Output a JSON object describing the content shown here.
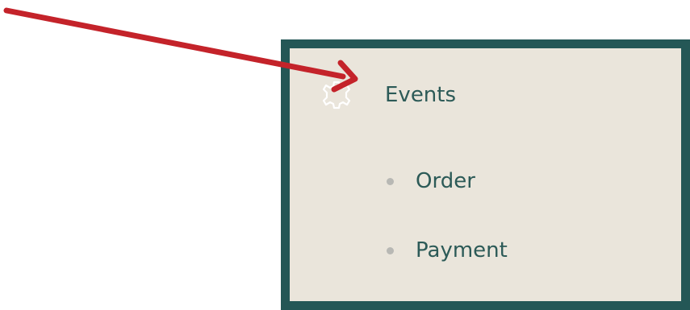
{
  "menu": {
    "header": {
      "label": "Events",
      "icon": "gear-icon"
    },
    "items": [
      {
        "label": "Order",
        "icon": "bullet-dot-icon"
      },
      {
        "label": "Payment",
        "icon": "bullet-dot-icon"
      }
    ]
  },
  "annotation": {
    "icon": "red-arrow-icon",
    "color": "#c4232a"
  },
  "colors": {
    "panel_border": "#245756",
    "panel_background": "#eae5db",
    "text": "#2c5a57",
    "bullet": "#b8b8b4"
  }
}
